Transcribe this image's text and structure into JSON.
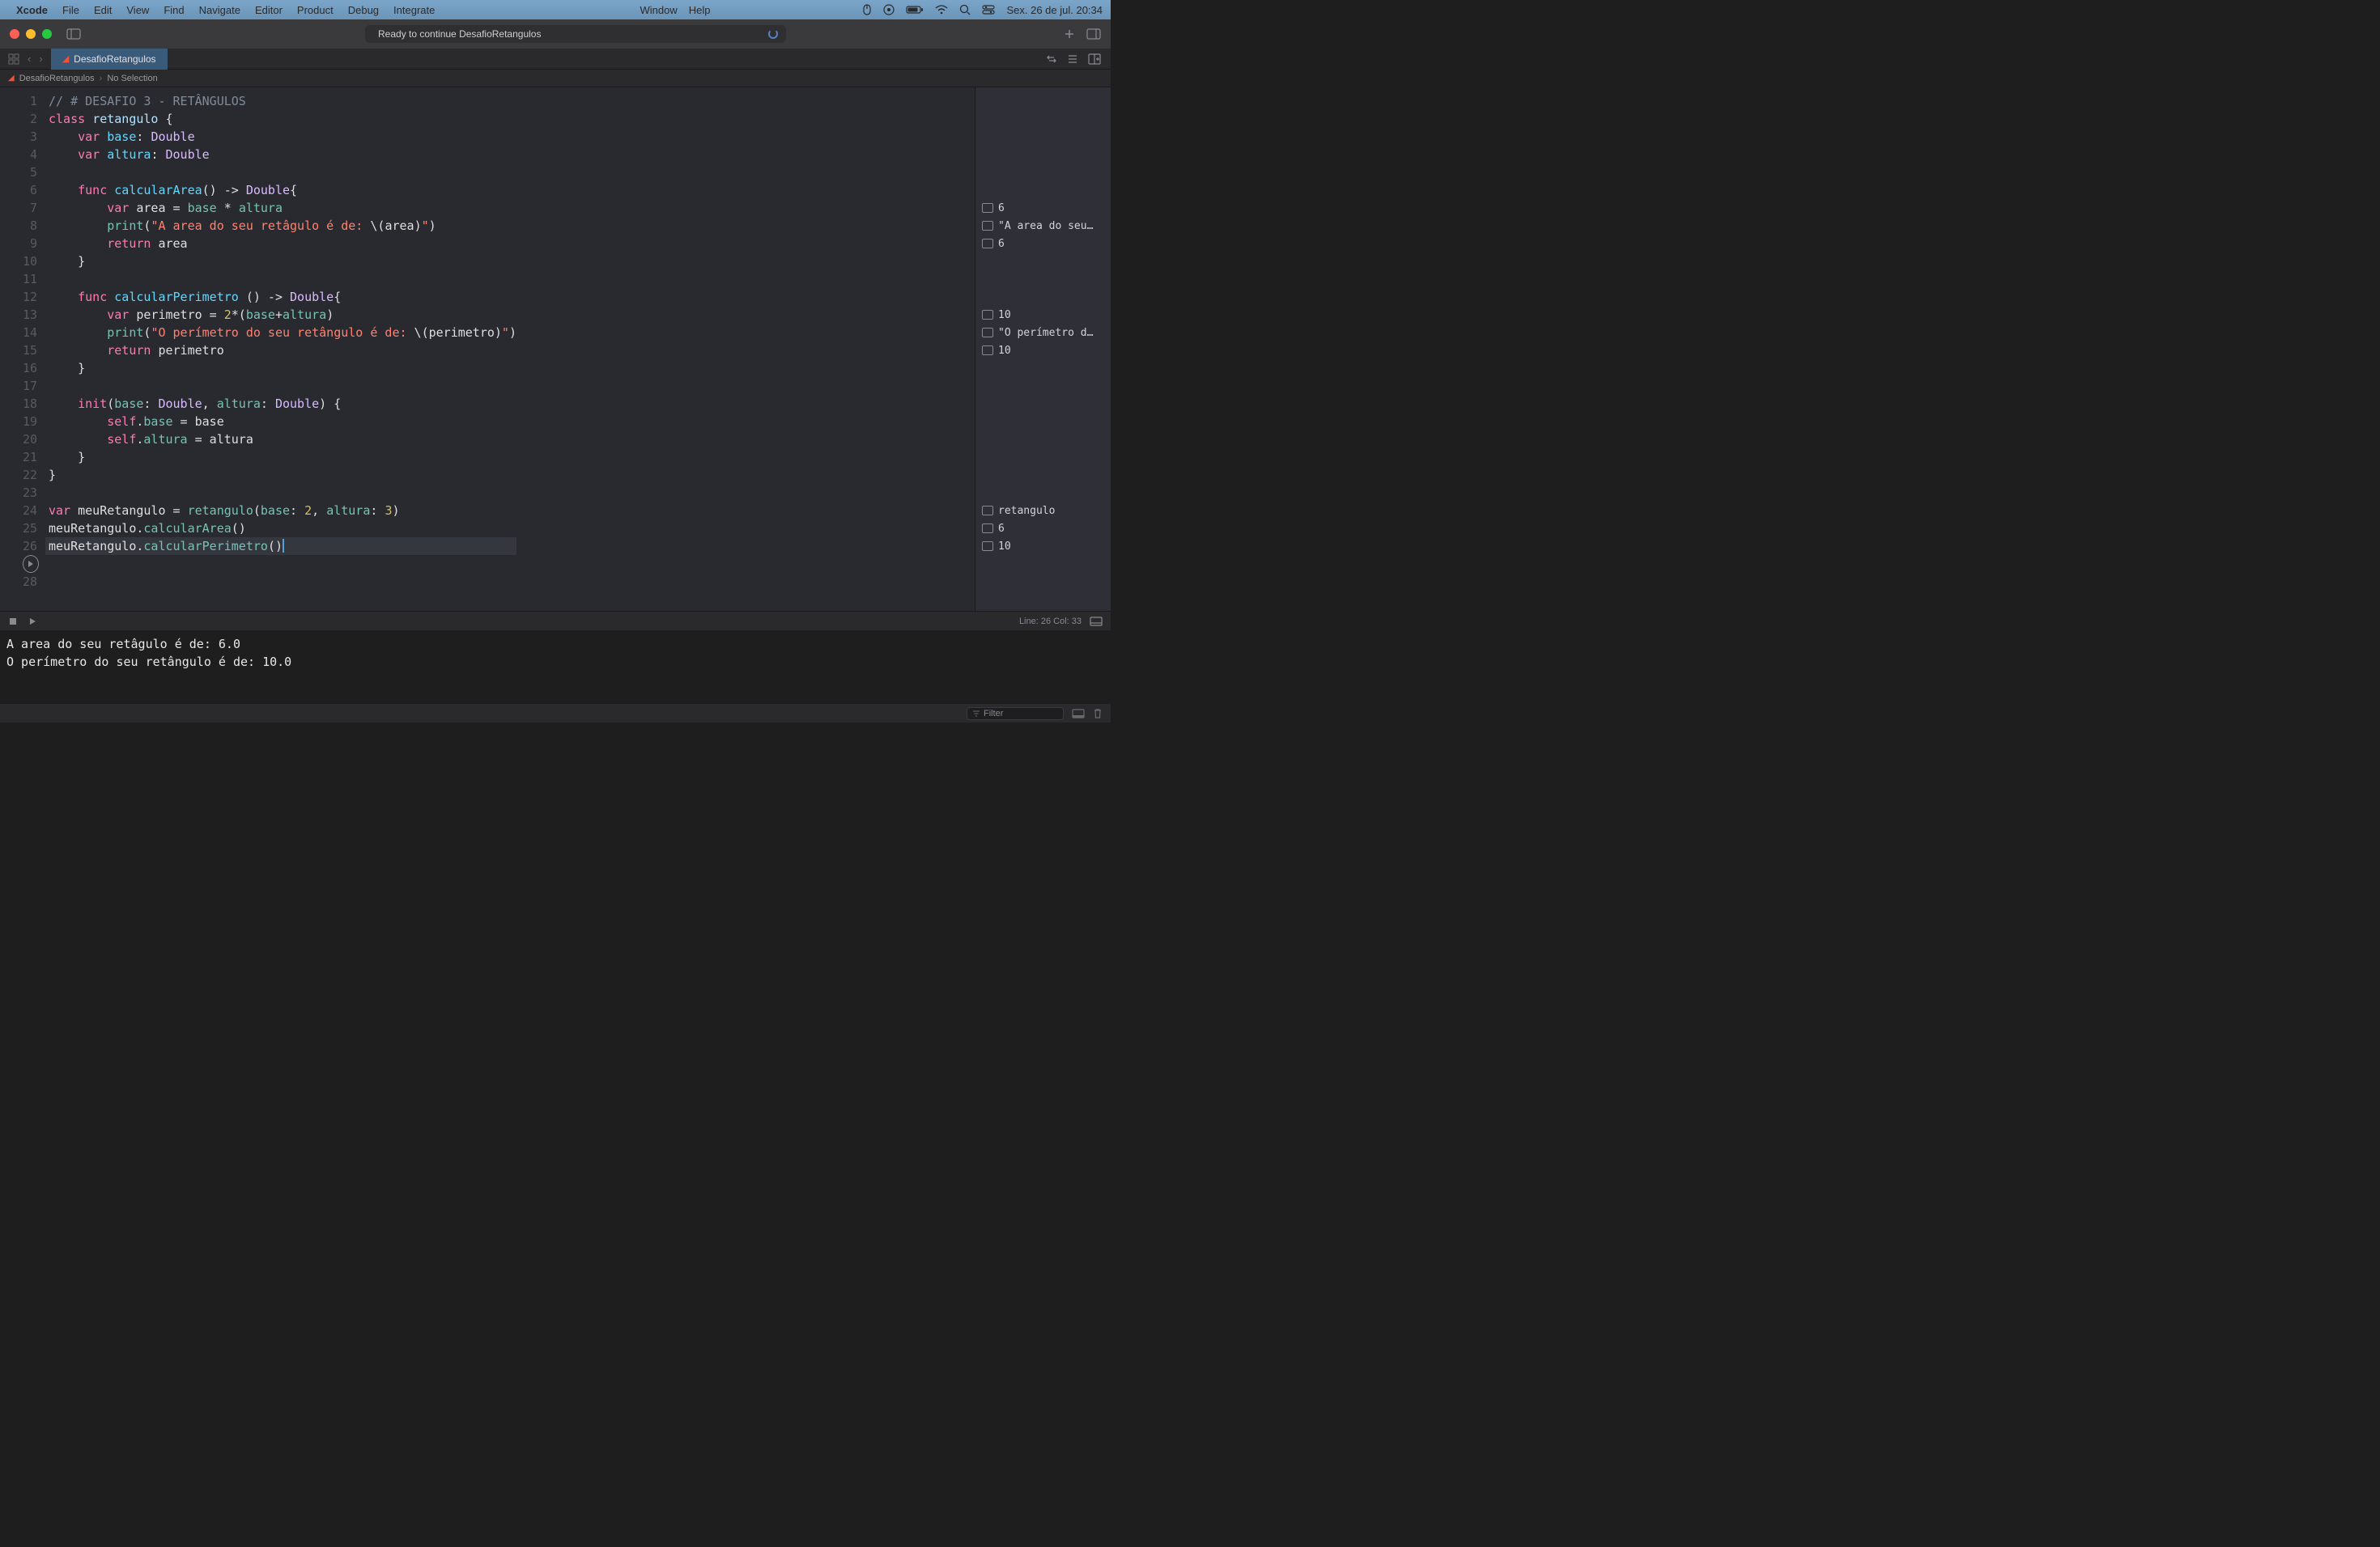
{
  "menubar": {
    "app": "Xcode",
    "items": [
      "File",
      "Edit",
      "View",
      "Find",
      "Navigate",
      "Editor",
      "Product",
      "Debug",
      "Integrate"
    ],
    "right_items": [
      "Window",
      "Help"
    ],
    "datetime": "Sex. 26 de jul.  20:34"
  },
  "titlebar": {
    "status": "Ready to continue DesafioRetangulos"
  },
  "tab": {
    "name": "DesafioRetangulos"
  },
  "breadcrumb": {
    "root": "DesafioRetangulos",
    "selection": "No Selection"
  },
  "code_lines": [
    {
      "n": 1,
      "tokens": [
        {
          "t": "// # DESAFIO 3 - RETÂNGULOS",
          "c": "c-comment"
        }
      ]
    },
    {
      "n": 2,
      "tokens": [
        {
          "t": "class",
          "c": "c-keyword"
        },
        {
          "t": " "
        },
        {
          "t": "retangulo",
          "c": "c-classname"
        },
        {
          "t": " {",
          "c": "c-default"
        }
      ]
    },
    {
      "n": 3,
      "tokens": [
        {
          "t": "    "
        },
        {
          "t": "var",
          "c": "c-keyword"
        },
        {
          "t": " "
        },
        {
          "t": "base",
          "c": "c-funcdef"
        },
        {
          "t": ": ",
          "c": "c-default"
        },
        {
          "t": "Double",
          "c": "c-type"
        }
      ]
    },
    {
      "n": 4,
      "tokens": [
        {
          "t": "    "
        },
        {
          "t": "var",
          "c": "c-keyword"
        },
        {
          "t": " "
        },
        {
          "t": "altura",
          "c": "c-funcdef"
        },
        {
          "t": ": ",
          "c": "c-default"
        },
        {
          "t": "Double",
          "c": "c-type"
        }
      ]
    },
    {
      "n": 5,
      "tokens": []
    },
    {
      "n": 6,
      "tokens": [
        {
          "t": "    "
        },
        {
          "t": "func",
          "c": "c-keyword"
        },
        {
          "t": " "
        },
        {
          "t": "calcularArea",
          "c": "c-funcdef"
        },
        {
          "t": "() -> ",
          "c": "c-default"
        },
        {
          "t": "Double",
          "c": "c-type"
        },
        {
          "t": "{",
          "c": "c-default"
        }
      ]
    },
    {
      "n": 7,
      "tokens": [
        {
          "t": "        "
        },
        {
          "t": "var",
          "c": "c-keyword"
        },
        {
          "t": " area = ",
          "c": "c-default"
        },
        {
          "t": "base",
          "c": "c-prop"
        },
        {
          "t": " * ",
          "c": "c-default"
        },
        {
          "t": "altura",
          "c": "c-prop"
        }
      ]
    },
    {
      "n": 8,
      "tokens": [
        {
          "t": "        "
        },
        {
          "t": "print",
          "c": "c-func"
        },
        {
          "t": "(",
          "c": "c-default"
        },
        {
          "t": "\"A area do seu retâgulo é de: ",
          "c": "c-string"
        },
        {
          "t": "\\(",
          "c": "c-default"
        },
        {
          "t": "area",
          "c": "c-default"
        },
        {
          "t": ")",
          "c": "c-default"
        },
        {
          "t": "\"",
          "c": "c-string"
        },
        {
          "t": ")",
          "c": "c-default"
        }
      ]
    },
    {
      "n": 9,
      "tokens": [
        {
          "t": "        "
        },
        {
          "t": "return",
          "c": "c-keyword"
        },
        {
          "t": " area",
          "c": "c-default"
        }
      ]
    },
    {
      "n": 10,
      "tokens": [
        {
          "t": "    }",
          "c": "c-default"
        }
      ]
    },
    {
      "n": 11,
      "tokens": []
    },
    {
      "n": 12,
      "tokens": [
        {
          "t": "    "
        },
        {
          "t": "func",
          "c": "c-keyword"
        },
        {
          "t": " "
        },
        {
          "t": "calcularPerimetro",
          "c": "c-funcdef"
        },
        {
          "t": " () -> ",
          "c": "c-default"
        },
        {
          "t": "Double",
          "c": "c-type"
        },
        {
          "t": "{",
          "c": "c-default"
        }
      ]
    },
    {
      "n": 13,
      "tokens": [
        {
          "t": "        "
        },
        {
          "t": "var",
          "c": "c-keyword"
        },
        {
          "t": " perimetro = ",
          "c": "c-default"
        },
        {
          "t": "2",
          "c": "c-number"
        },
        {
          "t": "*(",
          "c": "c-default"
        },
        {
          "t": "base",
          "c": "c-prop"
        },
        {
          "t": "+",
          "c": "c-default"
        },
        {
          "t": "altura",
          "c": "c-prop"
        },
        {
          "t": ")",
          "c": "c-default"
        }
      ]
    },
    {
      "n": 14,
      "tokens": [
        {
          "t": "        "
        },
        {
          "t": "print",
          "c": "c-func"
        },
        {
          "t": "(",
          "c": "c-default"
        },
        {
          "t": "\"O perímetro do seu retângulo é de: ",
          "c": "c-string"
        },
        {
          "t": "\\(",
          "c": "c-default"
        },
        {
          "t": "perimetro",
          "c": "c-default"
        },
        {
          "t": ")",
          "c": "c-default"
        },
        {
          "t": "\"",
          "c": "c-string"
        },
        {
          "t": ")",
          "c": "c-default"
        }
      ]
    },
    {
      "n": 15,
      "tokens": [
        {
          "t": "        "
        },
        {
          "t": "return",
          "c": "c-keyword"
        },
        {
          "t": " perimetro",
          "c": "c-default"
        }
      ]
    },
    {
      "n": 16,
      "tokens": [
        {
          "t": "    }",
          "c": "c-default"
        }
      ]
    },
    {
      "n": 17,
      "tokens": []
    },
    {
      "n": 18,
      "tokens": [
        {
          "t": "    "
        },
        {
          "t": "init",
          "c": "c-keyword"
        },
        {
          "t": "(",
          "c": "c-default"
        },
        {
          "t": "base",
          "c": "c-param"
        },
        {
          "t": ": ",
          "c": "c-default"
        },
        {
          "t": "Double",
          "c": "c-type"
        },
        {
          "t": ", ",
          "c": "c-default"
        },
        {
          "t": "altura",
          "c": "c-param"
        },
        {
          "t": ": ",
          "c": "c-default"
        },
        {
          "t": "Double",
          "c": "c-type"
        },
        {
          "t": ") {",
          "c": "c-default"
        }
      ]
    },
    {
      "n": 19,
      "tokens": [
        {
          "t": "        "
        },
        {
          "t": "self",
          "c": "c-self"
        },
        {
          "t": ".",
          "c": "c-default"
        },
        {
          "t": "base",
          "c": "c-prop"
        },
        {
          "t": " = base",
          "c": "c-default"
        }
      ]
    },
    {
      "n": 20,
      "tokens": [
        {
          "t": "        "
        },
        {
          "t": "self",
          "c": "c-self"
        },
        {
          "t": ".",
          "c": "c-default"
        },
        {
          "t": "altura",
          "c": "c-prop"
        },
        {
          "t": " = altura",
          "c": "c-default"
        }
      ]
    },
    {
      "n": 21,
      "tokens": [
        {
          "t": "    }",
          "c": "c-default"
        }
      ]
    },
    {
      "n": 22,
      "tokens": [
        {
          "t": "}",
          "c": "c-default"
        }
      ]
    },
    {
      "n": 23,
      "tokens": []
    },
    {
      "n": 24,
      "tokens": [
        {
          "t": "var",
          "c": "c-keyword"
        },
        {
          "t": " meuRetangulo = ",
          "c": "c-default"
        },
        {
          "t": "retangulo",
          "c": "c-func"
        },
        {
          "t": "(",
          "c": "c-default"
        },
        {
          "t": "base",
          "c": "c-param"
        },
        {
          "t": ": ",
          "c": "c-default"
        },
        {
          "t": "2",
          "c": "c-number"
        },
        {
          "t": ", ",
          "c": "c-default"
        },
        {
          "t": "altura",
          "c": "c-param"
        },
        {
          "t": ": ",
          "c": "c-default"
        },
        {
          "t": "3",
          "c": "c-number"
        },
        {
          "t": ")",
          "c": "c-default"
        }
      ]
    },
    {
      "n": 25,
      "tokens": [
        {
          "t": "meuRetangulo.",
          "c": "c-default"
        },
        {
          "t": "calcularArea",
          "c": "c-func"
        },
        {
          "t": "()",
          "c": "c-default"
        }
      ]
    },
    {
      "n": 26,
      "hl": true,
      "tokens": [
        {
          "t": "meuRetangulo.",
          "c": "c-default"
        },
        {
          "t": "calcularPerimetro",
          "c": "c-func"
        },
        {
          "t": "()",
          "c": "c-default"
        }
      ],
      "cursor": true
    },
    {
      "n": "",
      "play": true,
      "tokens": []
    },
    {
      "n": 28,
      "tokens": []
    }
  ],
  "results": [
    {
      "line": 7,
      "text": "6"
    },
    {
      "line": 8,
      "text": "\"A area do seu…"
    },
    {
      "line": 9,
      "text": "6"
    },
    {
      "line": 13,
      "text": "10"
    },
    {
      "line": 14,
      "text": "\"O perímetro d…"
    },
    {
      "line": 15,
      "text": "10"
    },
    {
      "line": 24,
      "text": "retangulo"
    },
    {
      "line": 25,
      "text": "6"
    },
    {
      "line": 26,
      "text": "10"
    }
  ],
  "console": {
    "status": "Line: 26  Col: 33",
    "output": [
      "A area do seu retâgulo é de: 6.0",
      "O perímetro do seu retângulo é de: 10.0"
    ],
    "filter_placeholder": "Filter"
  }
}
